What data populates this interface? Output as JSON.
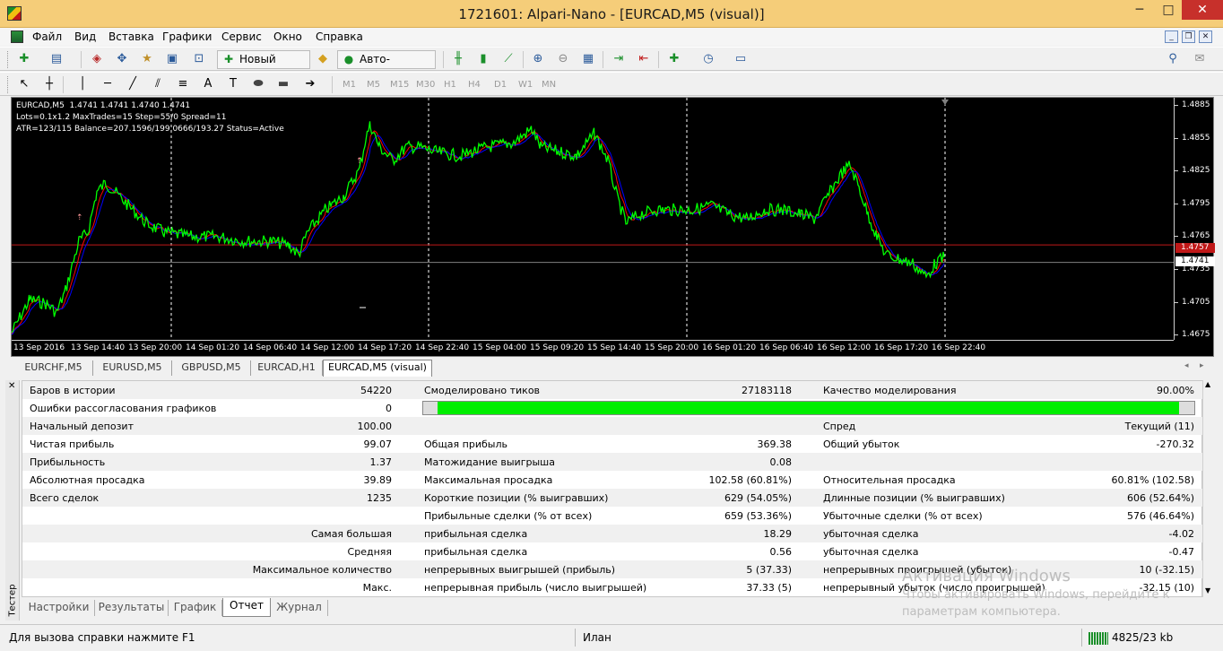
{
  "window": {
    "title": "1721601: Alpari-Nano - [EURCAD,M5 (visual)]",
    "minimize": "─",
    "maximize": "□",
    "close": "✕"
  },
  "menu": [
    "Файл",
    "Вид",
    "Вставка",
    "Графики",
    "Сервис",
    "Окно",
    "Справка"
  ],
  "mdi_buttons": [
    "_",
    "❐",
    "✕"
  ],
  "toolbar": {
    "new_order": "Новый ордер",
    "auto_trading": "Авто-торговля"
  },
  "timeframes": [
    "M1",
    "M5",
    "M15",
    "M30",
    "H1",
    "H4",
    "D1",
    "W1",
    "MN"
  ],
  "chart": {
    "ohlc_line": "EURCAD,M5  1.4741 1.4741 1.4740 1.4741",
    "info_line1": "Lots=0.1x1.2 MaxTrades=15 Step=55/0 Spread=11",
    "info_line2": "ATR=123/115 Balance=207.1596/199.0666/193.27 Status=Active",
    "price_ticks": [
      "1.4885",
      "1.4855",
      "1.4825",
      "1.4795",
      "1.4765",
      "1.4735",
      "1.4705",
      "1.4675"
    ],
    "price_tag_red": "1.4757",
    "price_tag_white": "1.4741",
    "time_ticks": [
      "13 Sep 2016",
      "13 Sep 14:40",
      "13 Sep 20:00",
      "14 Sep 01:20",
      "14 Sep 06:40",
      "14 Sep 12:00",
      "14 Sep 17:20",
      "14 Sep 22:40",
      "15 Sep 04:00",
      "15 Sep 09:20",
      "15 Sep 14:40",
      "15 Sep 20:00",
      "16 Sep 01:20",
      "16 Sep 06:40",
      "16 Sep 12:00",
      "16 Sep 17:20",
      "16 Sep 22:40"
    ],
    "colors": {
      "background": "#000000",
      "price_line": "#00ff00",
      "ma_line": "#0000ff",
      "ma2_line": "#ff0000",
      "ask_line": "#c01818"
    }
  },
  "chart_tabs": [
    "EURCHF,M5",
    "EURUSD,M5",
    "GBPUSD,M5",
    "EURCAD,H1",
    "EURCAD,M5 (visual)"
  ],
  "report": {
    "rows": [
      {
        "c1l": "Баров в истории",
        "c1v": "54220",
        "c2l": "Смоделировано тиков",
        "c2v": "27183118",
        "c3l": "Качество моделирования",
        "c3v": "90.00%"
      },
      {
        "c1l": "Ошибки рассогласования графиков",
        "c1v": "0",
        "c2l": "",
        "c2v": "",
        "c3l": "",
        "c3v": ""
      },
      {
        "c1l": "Начальный депозит",
        "c1v": "100.00",
        "c2l": "",
        "c2v": "",
        "c3l": "Спред",
        "c3v": "Текущий (11)"
      },
      {
        "c1l": "Чистая прибыль",
        "c1v": "99.07",
        "c2l": "Общая прибыль",
        "c2v": "369.38",
        "c3l": "Общий убыток",
        "c3v": "-270.32"
      },
      {
        "c1l": "Прибыльность",
        "c1v": "1.37",
        "c2l": "Матожидание выигрыша",
        "c2v": "0.08",
        "c3l": "",
        "c3v": ""
      },
      {
        "c1l": "Абсолютная просадка",
        "c1v": "39.89",
        "c2l": "Максимальная просадка",
        "c2v": "102.58 (60.81%)",
        "c3l": "Относительная просадка",
        "c3v": "60.81% (102.58)"
      },
      {
        "c1l": "Всего сделок",
        "c1v": "1235",
        "c2l": "Короткие позиции (% выигравших)",
        "c2v": "629 (54.05%)",
        "c3l": "Длинные позиции (% выигравших)",
        "c3v": "606 (52.64%)"
      },
      {
        "c1l": "",
        "c1v": "",
        "c2l": "Прибыльные сделки (% от всех)",
        "c2v": "659 (53.36%)",
        "c3l": "Убыточные сделки (% от всех)",
        "c3v": "576 (46.64%)"
      },
      {
        "c1l": "",
        "c1v": "Самая большая",
        "c2l": "прибыльная сделка",
        "c2v": "18.29",
        "c3l": "убыточная сделка",
        "c3v": "-4.02"
      },
      {
        "c1l": "",
        "c1v": "Средняя",
        "c2l": "прибыльная сделка",
        "c2v": "0.56",
        "c3l": "убыточная сделка",
        "c3v": "-0.47"
      },
      {
        "c1l": "",
        "c1v": "Максимальное количество",
        "c2l": "непрерывных выигрышей (прибыль)",
        "c2v": "5 (37.33)",
        "c3l": "непрерывных проигрышей (убыток)",
        "c3v": "10 (-32.15)"
      },
      {
        "c1l": "",
        "c1v": "Макс.",
        "c2l": "непрерывная прибыль (число выигрышей)",
        "c2v": "37.33 (5)",
        "c3l": "непрерывный убыток (число проигрышей)",
        "c3v": "-32.15 (10)"
      }
    ],
    "progress": 0.98
  },
  "tester_label": "Тестер",
  "bottom_tabs": [
    "Настройки",
    "Результаты",
    "График",
    "Отчет",
    "Журнал"
  ],
  "status": {
    "help": "Для вызова справки нажмите F1",
    "profile": "Илан",
    "traffic": "4825/23 kb"
  },
  "watermark": {
    "line1": "Активация Windows",
    "line2": "Чтобы активировать Windows, перейдите к",
    "line3": "параметрам компьютера."
  }
}
